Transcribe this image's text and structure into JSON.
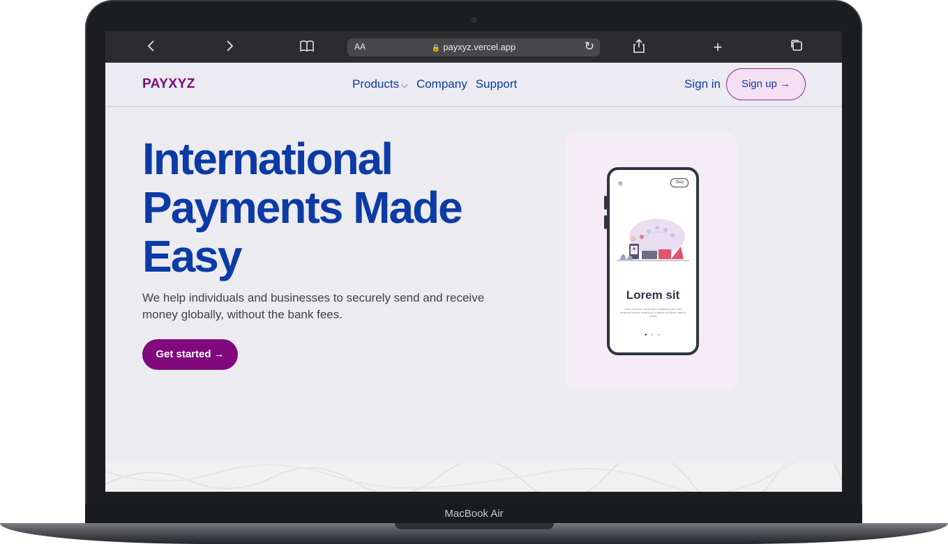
{
  "device": {
    "label": "MacBook Air"
  },
  "browser": {
    "back_glyph": "‹",
    "forward_glyph": "›",
    "reader_icon": "book-icon",
    "text_size": "AA",
    "url": "payxyz.vercel.app",
    "share_icon": "share-icon",
    "new_tab_glyph": "+",
    "tabs_icon": "tabs-icon"
  },
  "nav": {
    "logo": "PAYXYZ",
    "links": [
      "Products",
      "Company",
      "Support"
    ],
    "signin": "Sign in",
    "signup": "Sign up →"
  },
  "hero": {
    "title_lines": [
      "International",
      "Payments Made",
      "Easy"
    ],
    "subtitle": "We help individuals and businesses to securely send and receive money globally, without the bank fees.",
    "cta": "Get started →"
  },
  "phone": {
    "skip": "Skip",
    "heading": "Lorem sit",
    "body": "Dolor sit amet, consectetur adipiscing elit, sed eiusmod tempor incididunt ut labore et dolore magna aliqua",
    "dots": "● ○ ○"
  },
  "colors": {
    "brand": "#7b0b7e",
    "primary": "#0c3aa6",
    "cta_bg": "#800a7c",
    "signup_bg": "#f5dff3",
    "page_bg": "#ebebf0"
  }
}
